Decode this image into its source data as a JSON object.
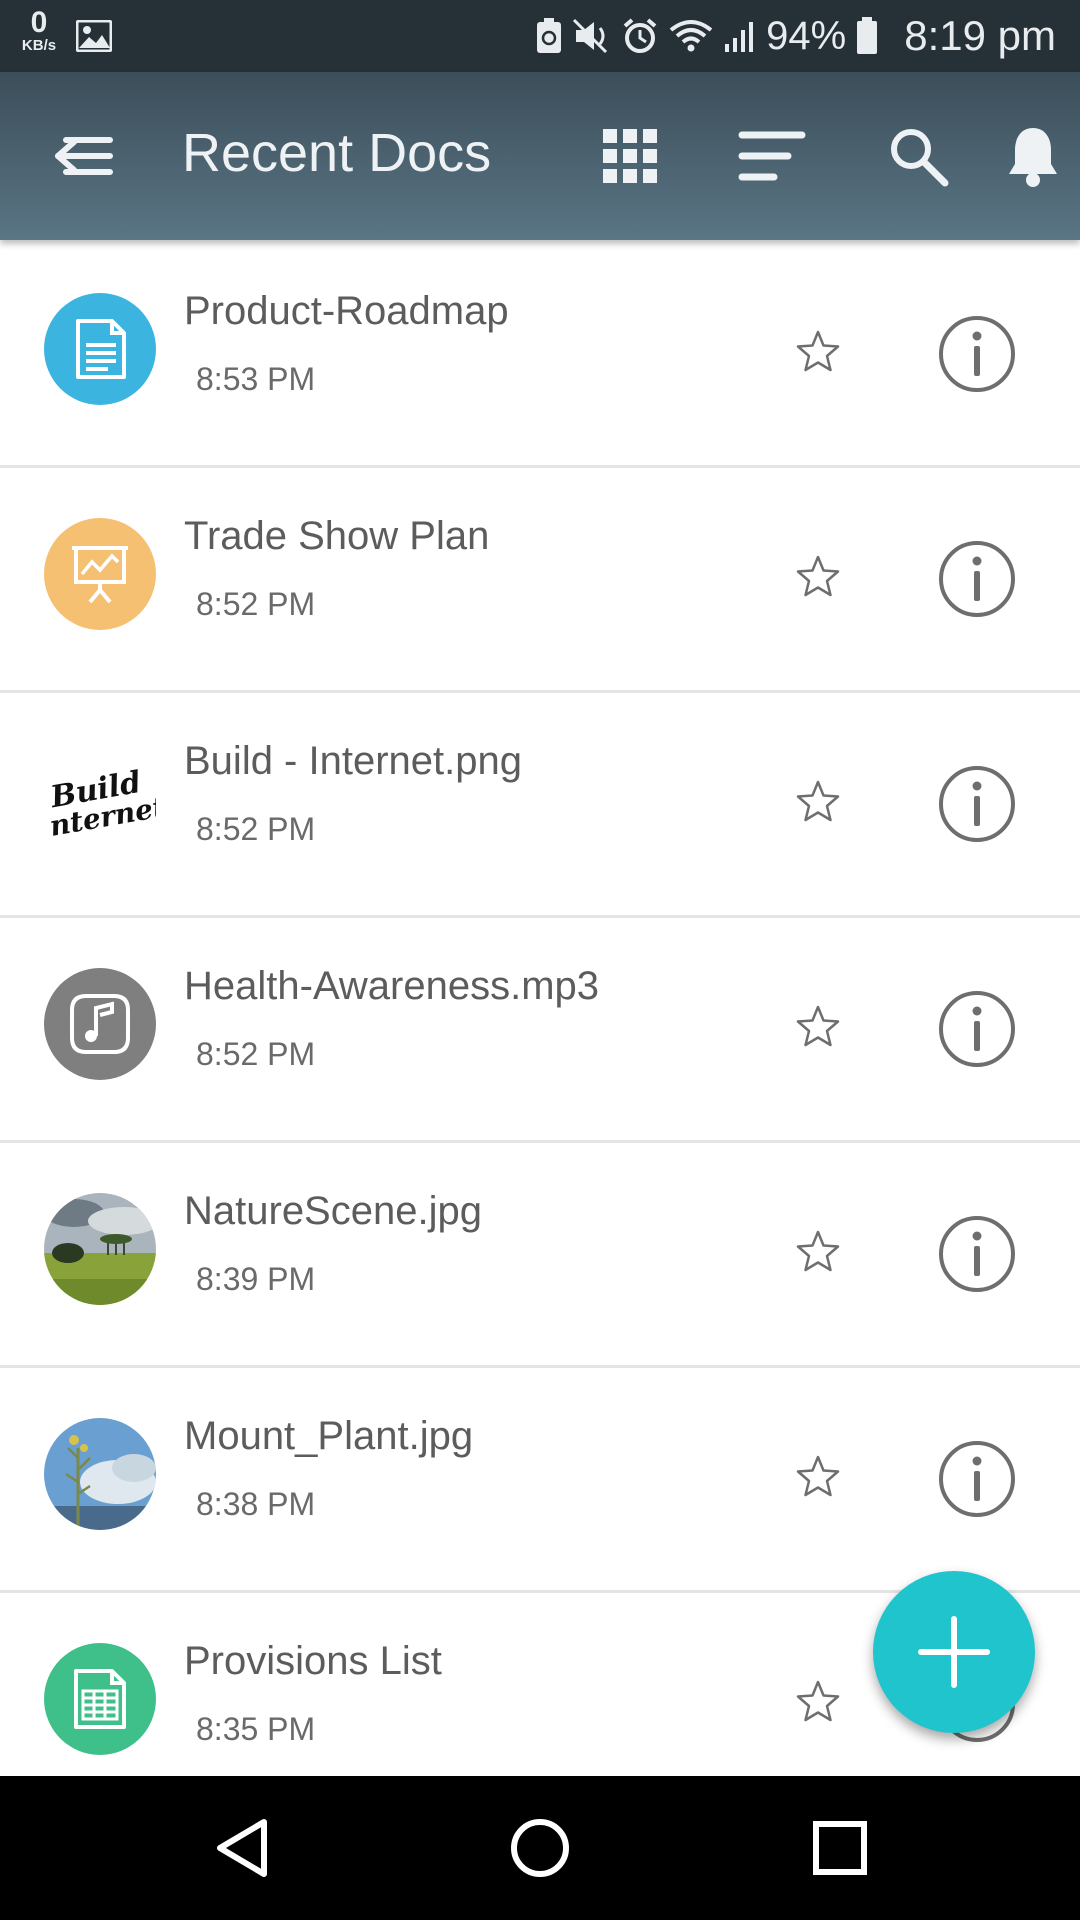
{
  "status_bar": {
    "net_speed_value": "0",
    "net_speed_unit": "KB/s",
    "battery": "94%",
    "time": "8:19 pm"
  },
  "app_bar": {
    "title": "Recent Docs"
  },
  "documents": [
    {
      "name": "Product-Roadmap",
      "time": "8:53 PM",
      "icon": "document-icon",
      "color": "#3cb4e0"
    },
    {
      "name": "Trade Show Plan",
      "time": "8:52 PM",
      "icon": "presentation-icon",
      "color": "#f5c071"
    },
    {
      "name": "Build - Internet.png",
      "time": "8:52 PM",
      "icon": "image-thumbnail"
    },
    {
      "name": "Health-Awareness.mp3",
      "time": "8:52 PM",
      "icon": "music-icon",
      "color": "#7f7f7f"
    },
    {
      "name": "NatureScene.jpg",
      "time": "8:39 PM",
      "icon": "photo-thumbnail"
    },
    {
      "name": "Mount_Plant.jpg",
      "time": "8:38 PM",
      "icon": "photo-thumbnail"
    },
    {
      "name": "Provisions List",
      "time": "8:35 PM",
      "icon": "spreadsheet-icon",
      "color": "#3fc08a"
    }
  ],
  "thumbnail_text": {
    "line1": "Build",
    "line2": "nternet"
  },
  "colors": {
    "status_bar": "#263037",
    "app_bar_top": "#3c4e5a",
    "app_bar_bottom": "#5a7584",
    "fab": "#1fc4cc"
  }
}
